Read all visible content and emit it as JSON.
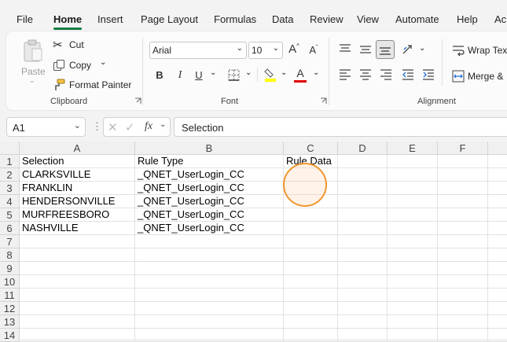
{
  "menu": {
    "tabs": [
      "File",
      "Home",
      "Insert",
      "Page Layout",
      "Formulas",
      "Data",
      "Review",
      "View",
      "Automate",
      "Help",
      "Acro"
    ],
    "active": "Home"
  },
  "ribbon": {
    "clipboard": {
      "paste_label": "Paste",
      "cut_label": "Cut",
      "copy_label": "Copy",
      "format_painter_label": "Format Painter",
      "group_label": "Clipboard"
    },
    "font": {
      "font_name": "Arial",
      "font_size": "10",
      "bold": "B",
      "italic": "I",
      "underline": "U",
      "font_color_glyph": "A",
      "grow_glyph": "A",
      "shrink_glyph": "A",
      "group_label": "Font",
      "colors": {
        "highlight": "#ffff00",
        "font_color": "#e00000"
      }
    },
    "alignment": {
      "wrap_text_label": "Wrap Text",
      "merge_label": "Merge &",
      "group_label": "Alignment"
    }
  },
  "formula_bar": {
    "name_box": "A1",
    "fx_label": "fx",
    "formula": "Selection"
  },
  "grid": {
    "columns": [
      "A",
      "B",
      "C",
      "D",
      "E",
      "F"
    ],
    "rows": [
      "1",
      "2",
      "3",
      "4",
      "5",
      "6",
      "7",
      "8",
      "9",
      "10",
      "11",
      "12",
      "13",
      "14"
    ],
    "cells": [
      [
        "Selection",
        "Rule Type",
        "Rule Data"
      ],
      [
        "CLARKSVILLE",
        "_QNET_UserLogin_CC",
        ""
      ],
      [
        "FRANKLIN",
        "_QNET_UserLogin_CC",
        ""
      ],
      [
        "HENDERSONVILLE",
        "_QNET_UserLogin_CC",
        ""
      ],
      [
        "MURFREESBORO",
        "_QNET_UserLogin_CC",
        ""
      ],
      [
        "NASHVILLE",
        "_QNET_UserLogin_CC",
        ""
      ]
    ]
  },
  "colors": {
    "accent": "#117b42",
    "click_marker": "#f0952e"
  }
}
